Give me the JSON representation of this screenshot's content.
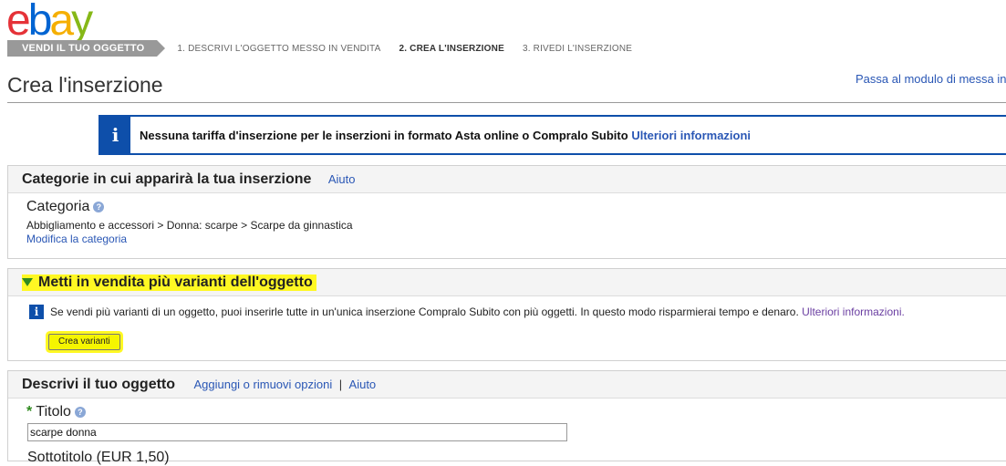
{
  "logo": {
    "e": "e",
    "b": "b",
    "a": "a",
    "y": "y"
  },
  "steps": {
    "active": "VENDI IL TUO OGGETTO",
    "s1": "1. DESCRIVI L'OGGETTO MESSO IN VENDITA",
    "s2": "2. CREA L'INSERZIONE",
    "s3": "3. RIVEDI L'INSERZIONE"
  },
  "page": {
    "title": "Crea l'inserzione",
    "form_link": "Passa al modulo di messa in vendita"
  },
  "notice": {
    "icon": "i",
    "text": "Nessuna tariffa d'inserzione per le inserzioni in formato Asta online o Compralo Subito",
    "link": "Ulteriori informazioni"
  },
  "categories": {
    "heading": "Categorie in cui apparirà la tua inserzione",
    "help": "Aiuto",
    "label": "Categoria",
    "help_icon": "?",
    "path": "Abbigliamento e accessori > Donna: scarpe > Scarpe da ginnastica",
    "edit_link": "Modifica la categoria"
  },
  "variants": {
    "heading": "Metti in vendita più varianti dell'oggetto",
    "icon": "i",
    "text": "Se vendi più varianti di un oggetto, puoi inserirle tutte in un'unica inserzione Compralo Subito con più oggetti. In questo modo risparmierai tempo e denaro.",
    "link": "Ulteriori informazioni.",
    "button": "Crea varianti"
  },
  "describe": {
    "heading": "Descrivi il tuo oggetto",
    "options_link": "Aggiungi o rimuovi opzioni",
    "separator": "|",
    "help": "Aiuto",
    "required_mark": "*",
    "title_label": "Titolo",
    "help_icon": "?",
    "title_value": "scarpe donna",
    "subtitle_label": "Sottotitolo (EUR 1,50)"
  },
  "colors": {
    "accent_blue": "#0e4faa",
    "link": "#2a57b5",
    "highlight": "#fff823",
    "required": "#2f8a1e"
  }
}
